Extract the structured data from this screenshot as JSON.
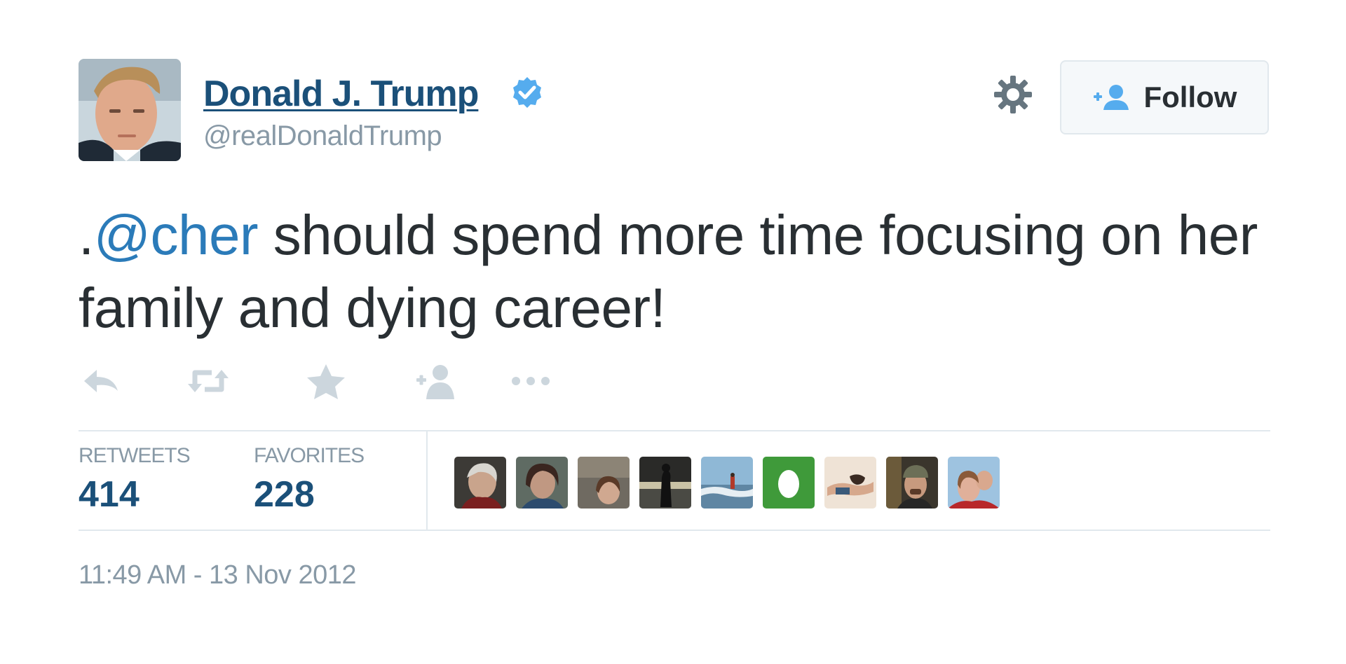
{
  "user": {
    "display_name": "Donald J. Trump",
    "handle": "@realDonaldTrump",
    "verified": true
  },
  "header": {
    "settings_icon": "gear-icon",
    "follow_icon": "add-user-icon",
    "follow_label": "Follow"
  },
  "tweet": {
    "prefix": ".",
    "mention": "@cher",
    "text": " should spend more time focusing on her family and dying career!"
  },
  "actions": [
    {
      "icon": "reply-icon"
    },
    {
      "icon": "retweet-icon"
    },
    {
      "icon": "favorite-star-icon"
    },
    {
      "icon": "follow-user-icon"
    },
    {
      "icon": "more-dots-icon"
    }
  ],
  "stats": {
    "retweets_label": "RETWEETS",
    "retweets_value": "414",
    "favorites_label": "FAVORITES",
    "favorites_value": "228"
  },
  "timestamp": "11:49 AM - 13 Nov 2012",
  "colors": {
    "name": "#1b5079",
    "link": "#2b7bb9",
    "muted": "#8899a6",
    "verified": "#55acee",
    "text": "#292f33"
  }
}
